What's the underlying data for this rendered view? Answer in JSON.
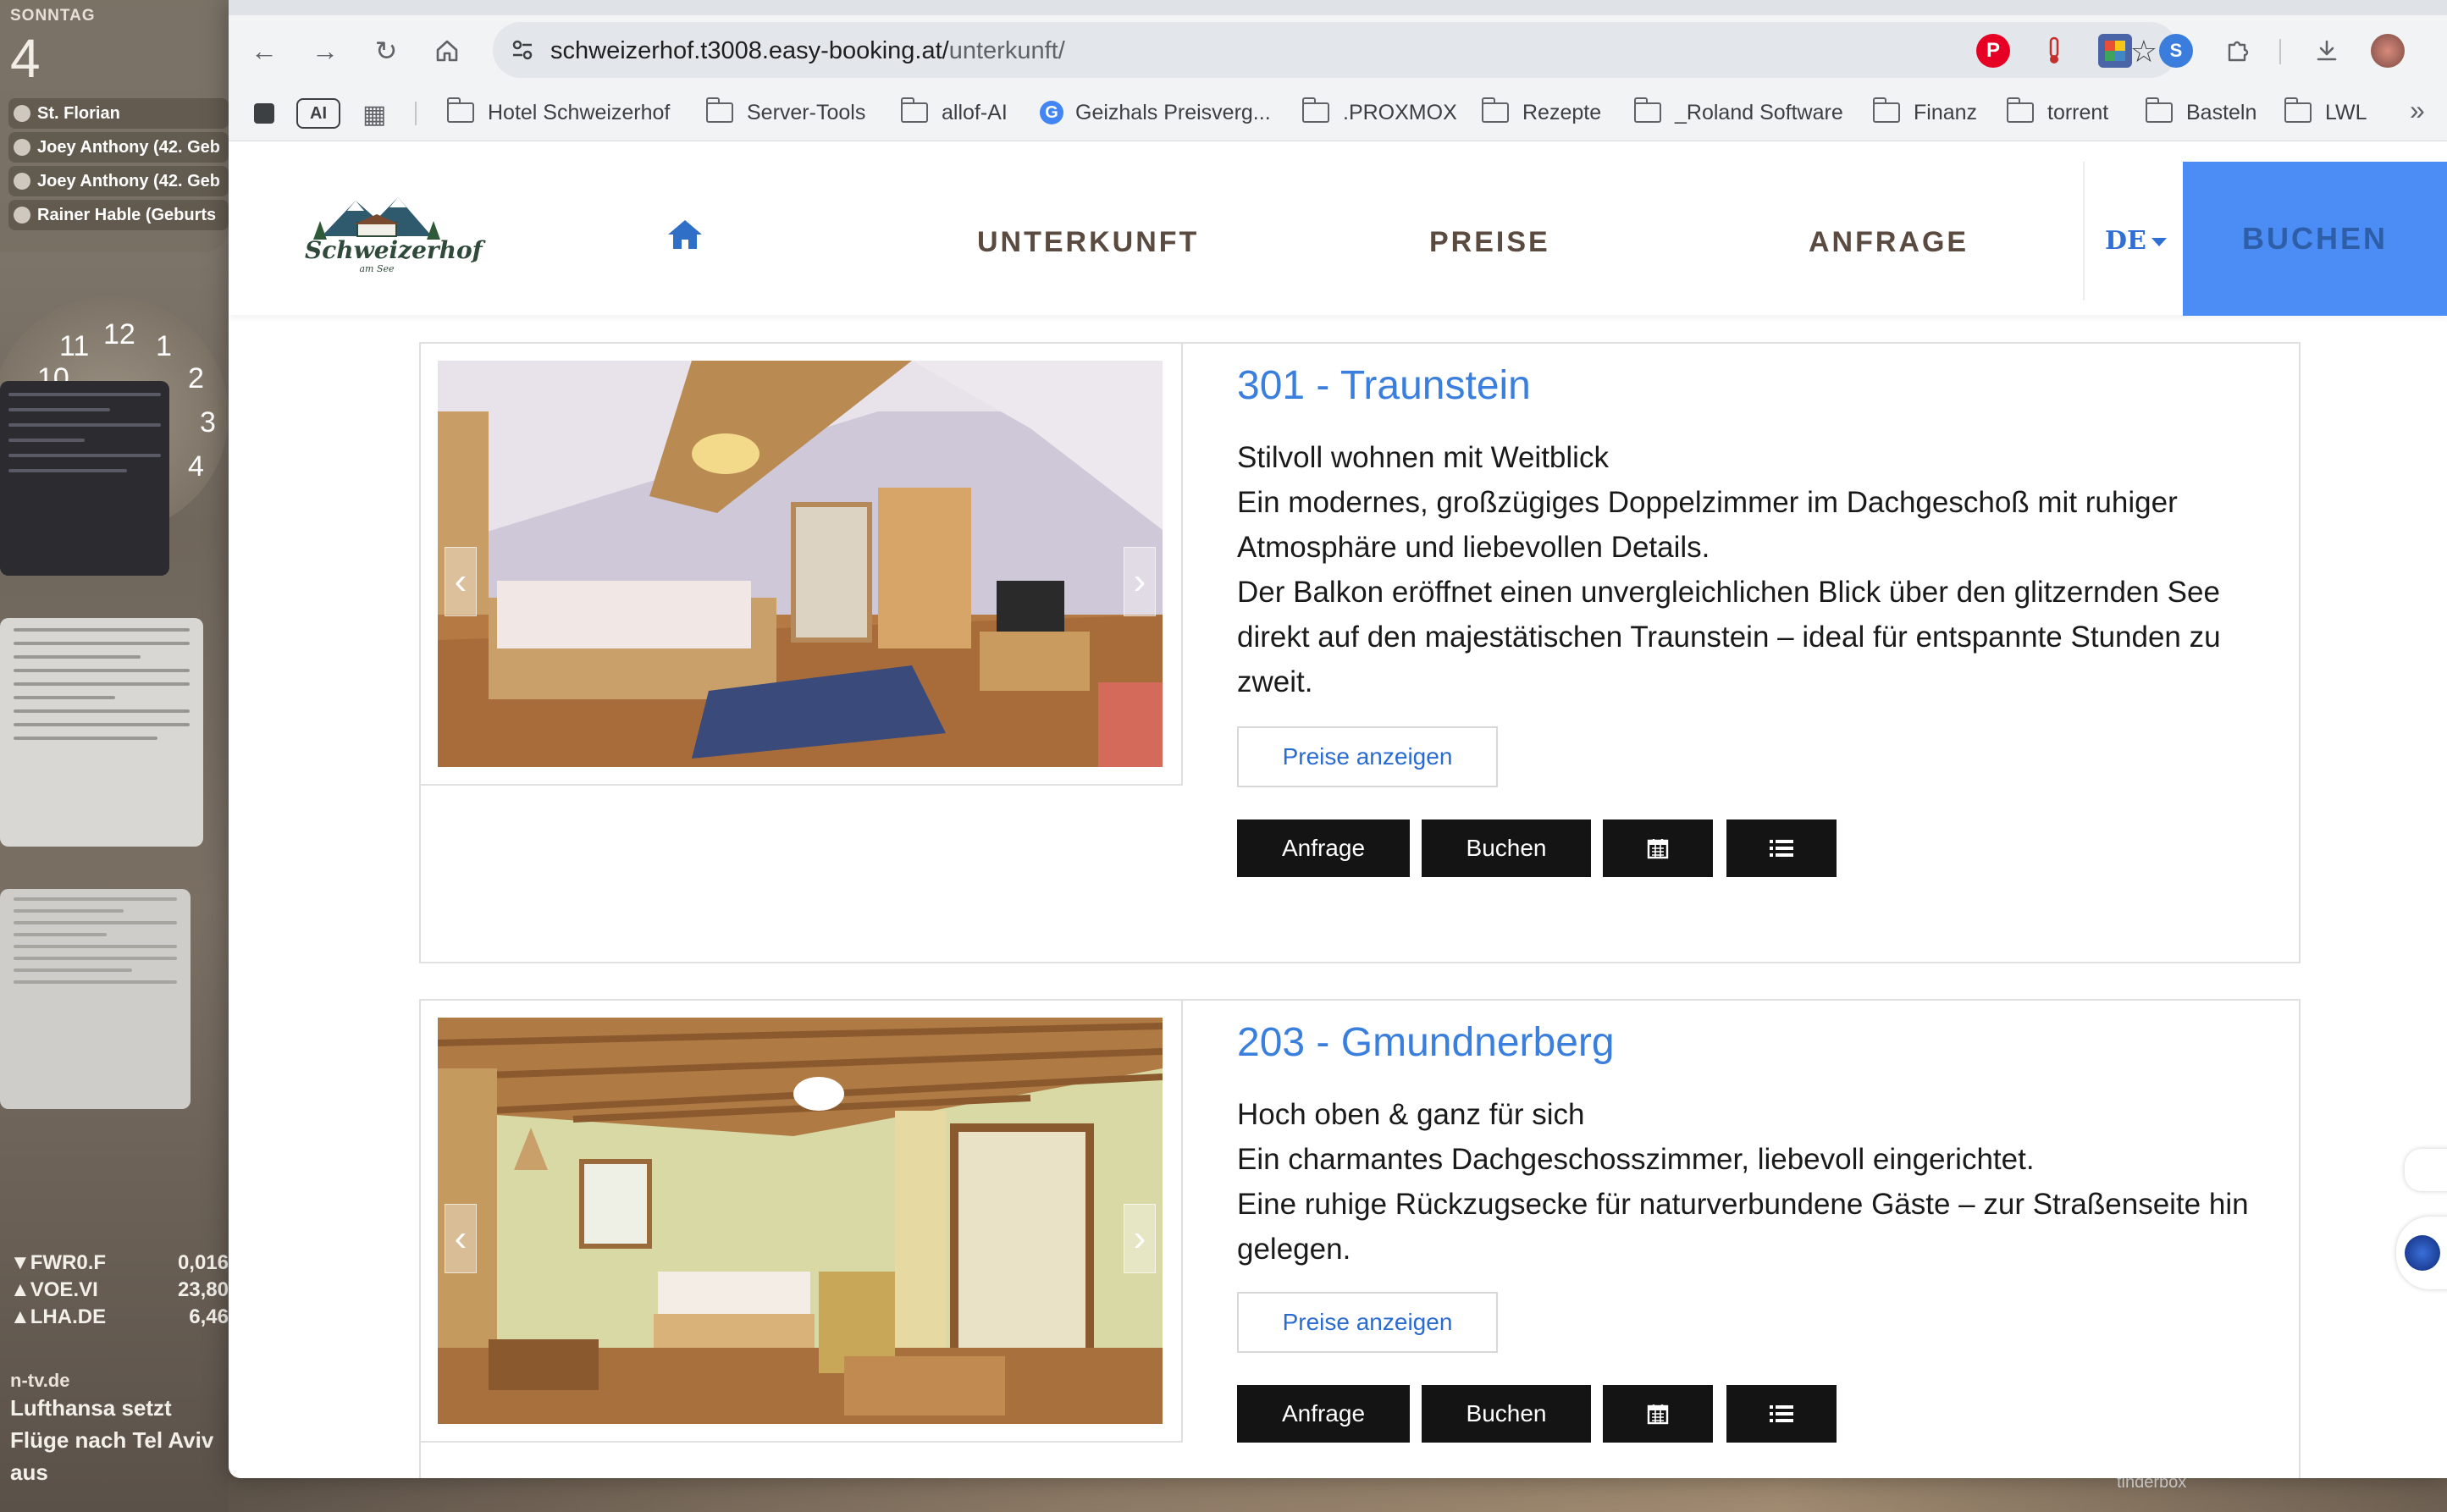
{
  "desktop": {
    "calendar": {
      "day_name": "SONNTAG",
      "day_number": "4",
      "events": [
        "St. Florian",
        "Joey Anthony (42. Geb",
        "Joey Anthony (42. Geb",
        "Rainer Hable (Geburts"
      ]
    },
    "clock_numbers": [
      "11",
      "12",
      "1",
      "2",
      "3",
      "4",
      "10"
    ],
    "stocks": [
      {
        "symbol": "▼FWR0.F",
        "value": "0,016"
      },
      {
        "symbol": "▲VOE.VI",
        "value": "23,80"
      },
      {
        "symbol": "▲LHA.DE",
        "value": "6,46"
      }
    ],
    "news": {
      "source": "n-tv.de",
      "headline": "Lufthansa setzt Flüge nach Tel Aviv aus"
    },
    "bottom_label": "tinderbox"
  },
  "browser": {
    "url_domain": "schweizerhof.t3008.easy-booking.at/",
    "url_path": "unterkunft/",
    "bookmarks": [
      "Hotel Schweizerhof",
      "Server-Tools",
      "allof-AI",
      "Geizhals Preisverg...",
      ".PROXMOX",
      "Rezepte",
      "_Roland Software",
      "Finanz",
      "torrent",
      "Basteln",
      "LWL"
    ],
    "ai_badge": "AI"
  },
  "site": {
    "logo_text": "Schweizerhof",
    "logo_sub": "am See",
    "menu": [
      "UNTERKUNFT",
      "PREISE",
      "ANFRAGE"
    ],
    "language": "DE",
    "book_label": "BUCHEN"
  },
  "rooms": [
    {
      "title": "301 - Traunstein",
      "description": [
        "Stilvoll wohnen mit Weitblick",
        "Ein modernes, großzügiges Doppelzimmer im Dachgeschoß mit ruhiger Atmosphäre und liebevollen Details.",
        "Der Balkon eröffnet einen unvergleichlichen Blick über den glitzernden See direkt auf den majestätischen Traunstein – ideal für entspannte Stunden zu zweit."
      ],
      "price_button": "Preise anzeigen",
      "inquiry_button": "Anfrage",
      "book_button": "Buchen"
    },
    {
      "title": "203 - Gmundnerberg",
      "description": [
        "Hoch oben & ganz für sich",
        "Ein charmantes Dachgeschosszimmer, liebevoll eingerichtet.",
        "Eine ruhige Rückzugsecke für naturverbundene Gäste – zur Straßenseite hin gelegen."
      ],
      "price_button": "Preise anzeigen",
      "inquiry_button": "Anfrage",
      "book_button": "Buchen"
    }
  ],
  "colors": {
    "accent_blue": "#3a7fde",
    "book_button_bg": "#4b8df5",
    "action_button_bg": "#141414",
    "menu_text": "#5a4a40"
  }
}
